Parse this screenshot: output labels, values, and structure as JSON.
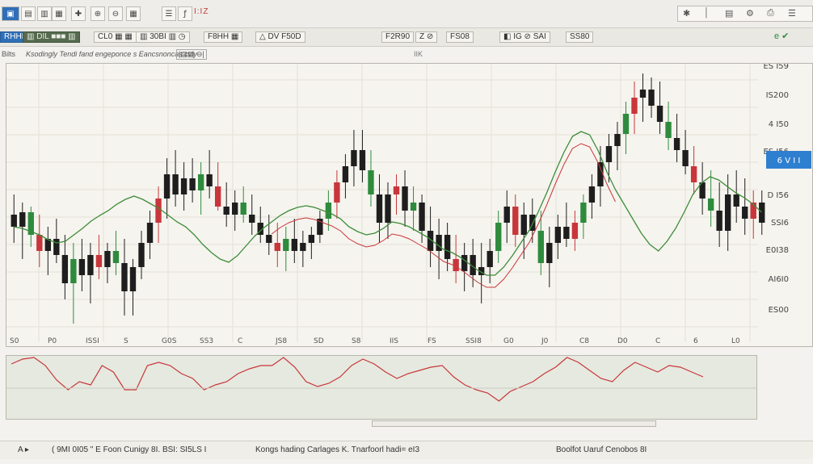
{
  "toolbar": {
    "buttons": [
      {
        "name": "new-chart-button",
        "glyph": "▣"
      },
      {
        "name": "open-button",
        "glyph": "▤"
      },
      {
        "name": "save-button",
        "glyph": "▥"
      },
      {
        "name": "print-button",
        "glyph": "▦"
      },
      {
        "name": "crosshair-button",
        "glyph": "✚"
      },
      {
        "name": "zoom-in-button",
        "glyph": "⊕"
      },
      {
        "name": "zoom-out-button",
        "glyph": "⊖"
      },
      {
        "name": "grid-button",
        "glyph": "▦"
      },
      {
        "name": "properties-button",
        "glyph": "☰"
      },
      {
        "name": "indicator-button",
        "glyph": "ƒ"
      }
    ],
    "title_fragment": "I:IZ",
    "right_buttons": [
      {
        "name": "expand-icon",
        "glyph": "✱"
      },
      {
        "name": "line-icon",
        "glyph": "│"
      },
      {
        "name": "bar-icon",
        "glyph": "▤"
      },
      {
        "name": "settings-icon",
        "glyph": "⚙"
      },
      {
        "name": "print-icon",
        "glyph": "⎙"
      },
      {
        "name": "menu-icon",
        "glyph": "☰"
      }
    ]
  },
  "toolbar2": {
    "items": [
      {
        "label": "RHHF"
      },
      {
        "label": "▥ DIL ■■■ ▥"
      },
      {
        "label": "CL0 ▦ ▦"
      },
      {
        "label": "▥ 30BI ▥ ◷"
      },
      {
        "label": "F8HH ▦"
      },
      {
        "label": "△ DV F50D"
      },
      {
        "label": "F2R90"
      },
      {
        "label": "Z ⊘"
      },
      {
        "label": "FS08"
      },
      {
        "label": "◧ IG ⊘ SAI"
      },
      {
        "label": "SS80"
      }
    ],
    "trailing": "e ✔"
  },
  "infobar": {
    "left": "Bilts",
    "middle": "Ksodingly  Tendi fand  engeponce s  Eancsnoncas cvly",
    "tag": "|▤▤ ⊖|",
    "center_label": "IIK"
  },
  "price_axis": {
    "labels": [
      "ES I59",
      "IS200",
      "4 I50",
      "ES I56",
      "D I56",
      "SSI6",
      "E0I38",
      "AI6I0",
      "ES00"
    ],
    "current_value": "6 V I I"
  },
  "time_axis": {
    "labels": [
      "S0",
      "P0",
      "ISSI",
      "S",
      "G0S",
      "SS3",
      "C",
      "JS8",
      "SD",
      "S8",
      "IIS",
      "FS",
      "SSI8",
      "G0",
      "J0",
      "C8",
      "D0",
      "C",
      "6",
      "L0"
    ]
  },
  "chart_data": {
    "type": "candlestick",
    "series": [
      {
        "name": "candles",
        "values": [
          {
            "o": 265,
            "h": 240,
            "l": 300,
            "c": 280
          },
          {
            "o": 280,
            "h": 250,
            "l": 320,
            "c": 262
          },
          {
            "o": 262,
            "h": 255,
            "l": 305,
            "c": 290
          },
          {
            "o": 290,
            "h": 265,
            "l": 330,
            "c": 310
          },
          {
            "o": 310,
            "h": 280,
            "l": 340,
            "c": 295
          },
          {
            "o": 295,
            "h": 270,
            "l": 325,
            "c": 315
          },
          {
            "o": 315,
            "h": 290,
            "l": 370,
            "c": 350
          },
          {
            "o": 350,
            "h": 300,
            "l": 400,
            "c": 320
          },
          {
            "o": 320,
            "h": 295,
            "l": 360,
            "c": 340
          },
          {
            "o": 340,
            "h": 300,
            "l": 375,
            "c": 315
          },
          {
            "o": 315,
            "h": 290,
            "l": 345,
            "c": 330
          },
          {
            "o": 330,
            "h": 300,
            "l": 350,
            "c": 310
          },
          {
            "o": 310,
            "h": 285,
            "l": 340,
            "c": 325
          },
          {
            "o": 325,
            "h": 295,
            "l": 390,
            "c": 360
          },
          {
            "o": 360,
            "h": 320,
            "l": 390,
            "c": 330
          },
          {
            "o": 330,
            "h": 285,
            "l": 345,
            "c": 300
          },
          {
            "o": 300,
            "h": 260,
            "l": 320,
            "c": 275
          },
          {
            "o": 275,
            "h": 230,
            "l": 300,
            "c": 245
          },
          {
            "o": 245,
            "h": 195,
            "l": 270,
            "c": 215
          },
          {
            "o": 215,
            "h": 185,
            "l": 255,
            "c": 240
          },
          {
            "o": 240,
            "h": 200,
            "l": 260,
            "c": 220
          },
          {
            "o": 220,
            "h": 195,
            "l": 250,
            "c": 235
          },
          {
            "o": 235,
            "h": 200,
            "l": 265,
            "c": 215
          },
          {
            "o": 215,
            "h": 185,
            "l": 245,
            "c": 230
          },
          {
            "o": 230,
            "h": 200,
            "l": 260,
            "c": 255
          },
          {
            "o": 255,
            "h": 225,
            "l": 280,
            "c": 265
          },
          {
            "o": 265,
            "h": 235,
            "l": 285,
            "c": 250
          },
          {
            "o": 250,
            "h": 230,
            "l": 275,
            "c": 265
          },
          {
            "o": 265,
            "h": 240,
            "l": 290,
            "c": 275
          },
          {
            "o": 275,
            "h": 255,
            "l": 300,
            "c": 290
          },
          {
            "o": 290,
            "h": 265,
            "l": 315,
            "c": 300
          },
          {
            "o": 300,
            "h": 275,
            "l": 330,
            "c": 310
          },
          {
            "o": 310,
            "h": 280,
            "l": 335,
            "c": 295
          },
          {
            "o": 295,
            "h": 270,
            "l": 325,
            "c": 310
          },
          {
            "o": 310,
            "h": 285,
            "l": 330,
            "c": 300
          },
          {
            "o": 300,
            "h": 280,
            "l": 320,
            "c": 290
          },
          {
            "o": 290,
            "h": 260,
            "l": 300,
            "c": 270
          },
          {
            "o": 270,
            "h": 235,
            "l": 285,
            "c": 250
          },
          {
            "o": 250,
            "h": 210,
            "l": 270,
            "c": 225
          },
          {
            "o": 225,
            "h": 190,
            "l": 245,
            "c": 205
          },
          {
            "o": 205,
            "h": 160,
            "l": 230,
            "c": 185
          },
          {
            "o": 185,
            "h": 160,
            "l": 225,
            "c": 210
          },
          {
            "o": 210,
            "h": 185,
            "l": 255,
            "c": 240
          },
          {
            "o": 240,
            "h": 215,
            "l": 300,
            "c": 275
          },
          {
            "o": 275,
            "h": 225,
            "l": 295,
            "c": 240
          },
          {
            "o": 240,
            "h": 215,
            "l": 265,
            "c": 230
          },
          {
            "o": 230,
            "h": 210,
            "l": 280,
            "c": 260
          },
          {
            "o": 260,
            "h": 230,
            "l": 285,
            "c": 250
          },
          {
            "o": 250,
            "h": 240,
            "l": 300,
            "c": 285
          },
          {
            "o": 285,
            "h": 255,
            "l": 330,
            "c": 310
          },
          {
            "o": 310,
            "h": 270,
            "l": 345,
            "c": 290
          },
          {
            "o": 290,
            "h": 275,
            "l": 335,
            "c": 320
          },
          {
            "o": 320,
            "h": 290,
            "l": 350,
            "c": 335
          },
          {
            "o": 335,
            "h": 300,
            "l": 360,
            "c": 315
          },
          {
            "o": 315,
            "h": 295,
            "l": 355,
            "c": 340
          },
          {
            "o": 340,
            "h": 300,
            "l": 375,
            "c": 330
          },
          {
            "o": 330,
            "h": 295,
            "l": 350,
            "c": 310
          },
          {
            "o": 310,
            "h": 260,
            "l": 325,
            "c": 275
          },
          {
            "o": 275,
            "h": 235,
            "l": 300,
            "c": 255
          },
          {
            "o": 255,
            "h": 240,
            "l": 305,
            "c": 290
          },
          {
            "o": 290,
            "h": 250,
            "l": 320,
            "c": 265
          },
          {
            "o": 265,
            "h": 245,
            "l": 300,
            "c": 285
          },
          {
            "o": 285,
            "h": 260,
            "l": 340,
            "c": 325
          },
          {
            "o": 325,
            "h": 280,
            "l": 355,
            "c": 300
          },
          {
            "o": 300,
            "h": 265,
            "l": 320,
            "c": 280
          },
          {
            "o": 280,
            "h": 250,
            "l": 305,
            "c": 295
          },
          {
            "o": 295,
            "h": 260,
            "l": 310,
            "c": 275
          },
          {
            "o": 275,
            "h": 240,
            "l": 295,
            "c": 250
          },
          {
            "o": 250,
            "h": 215,
            "l": 270,
            "c": 230
          },
          {
            "o": 230,
            "h": 180,
            "l": 255,
            "c": 200
          },
          {
            "o": 200,
            "h": 165,
            "l": 225,
            "c": 180
          },
          {
            "o": 180,
            "h": 150,
            "l": 210,
            "c": 165
          },
          {
            "o": 165,
            "h": 125,
            "l": 190,
            "c": 140
          },
          {
            "o": 140,
            "h": 100,
            "l": 165,
            "c": 120
          },
          {
            "o": 120,
            "h": 90,
            "l": 150,
            "c": 110
          },
          {
            "o": 110,
            "h": 95,
            "l": 145,
            "c": 130
          },
          {
            "o": 130,
            "h": 100,
            "l": 165,
            "c": 150
          },
          {
            "o": 150,
            "h": 125,
            "l": 185,
            "c": 170
          },
          {
            "o": 170,
            "h": 140,
            "l": 200,
            "c": 185
          },
          {
            "o": 185,
            "h": 160,
            "l": 215,
            "c": 205
          },
          {
            "o": 205,
            "h": 180,
            "l": 240,
            "c": 225
          },
          {
            "o": 225,
            "h": 200,
            "l": 265,
            "c": 245
          },
          {
            "o": 245,
            "h": 210,
            "l": 280,
            "c": 260
          },
          {
            "o": 260,
            "h": 225,
            "l": 305,
            "c": 285
          },
          {
            "o": 285,
            "h": 215,
            "l": 310,
            "c": 240
          },
          {
            "o": 240,
            "h": 210,
            "l": 275,
            "c": 255
          },
          {
            "o": 255,
            "h": 220,
            "l": 290,
            "c": 270
          },
          {
            "o": 270,
            "h": 235,
            "l": 295,
            "c": 250
          },
          {
            "o": 250,
            "h": 235,
            "l": 290,
            "c": 275
          }
        ]
      },
      {
        "name": "moving-average",
        "values": [
          290,
          292,
          296,
          300,
          306,
          310,
          308,
          300,
          292,
          283,
          276,
          270,
          262,
          256,
          252,
          256,
          262,
          268,
          276,
          284,
          290,
          300,
          312,
          322,
          330,
          334,
          326,
          314,
          302,
          292,
          284,
          276,
          270,
          266,
          264,
          266,
          270,
          274,
          280,
          290,
          296,
          300,
          298,
          292,
          284,
          286,
          290,
          296,
          302,
          310,
          318,
          322,
          328,
          336,
          344,
          350,
          350,
          340,
          326,
          310,
          294,
          272,
          248,
          222,
          198,
          178,
          172,
          176,
          196,
          222,
          244,
          262,
          280,
          298,
          312,
          320,
          308,
          292,
          272,
          250,
          236,
          228,
          232,
          240,
          248,
          254,
          262,
          272
        ]
      }
    ],
    "indicator": {
      "name": "oscillator",
      "values": [
        468,
        462,
        460,
        470,
        488,
        500,
        490,
        494,
        470,
        478,
        500,
        500,
        470,
        466,
        470,
        480,
        486,
        500,
        494,
        490,
        480,
        474,
        470,
        470,
        460,
        472,
        490,
        496,
        492,
        484,
        470,
        462,
        468,
        478,
        486,
        480,
        476,
        472,
        470,
        484,
        494,
        500,
        504,
        514,
        502,
        496,
        490,
        480,
        472,
        460,
        466,
        476,
        486,
        490,
        476,
        466,
        472,
        478,
        470,
        472,
        478,
        484
      ]
    }
  }
}
